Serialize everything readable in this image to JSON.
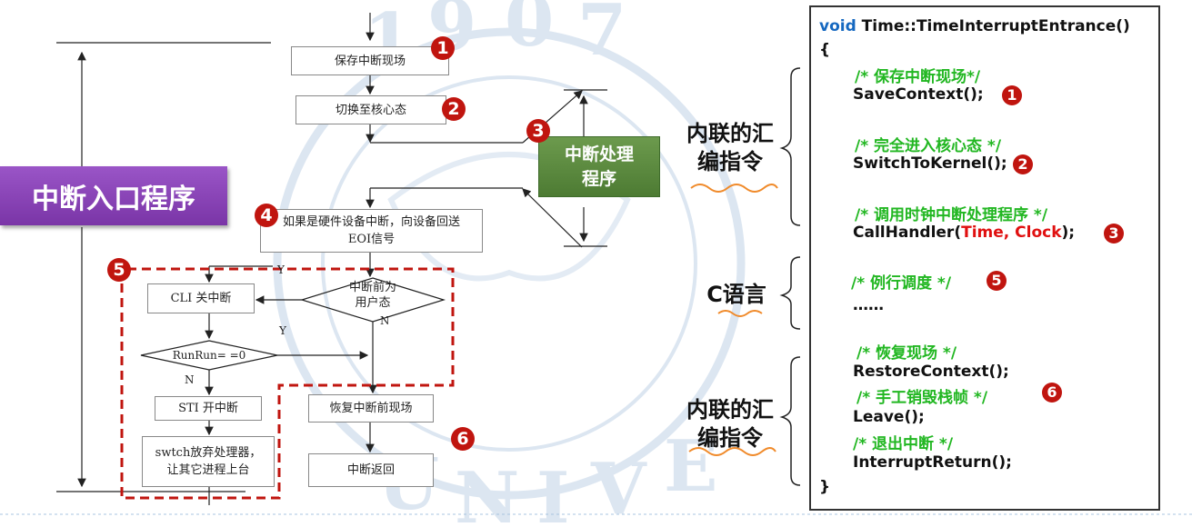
{
  "entry_label": "中断入口程序",
  "flowchart": {
    "save_context": "保存中断现场",
    "switch_kernel": "切换至核心态",
    "eoi_line1": "如果是硬件设备中断，向设备回送",
    "eoi_line2": "EOI信号",
    "cli": "CLI 关中断",
    "user_mode_line1": "中断前为",
    "user_mode_line2": "用户态",
    "runrun": "RunRun= =0",
    "sti": "STI 开中断",
    "switch_line1": "swtch放弃处理器，",
    "switch_line2": "让其它进程上台",
    "restore": "恢复中断前现场",
    "return": "中断返回",
    "label_y_top": "Y",
    "label_n_right": "N",
    "label_y_mid": "Y",
    "label_n_bottom": "N"
  },
  "handler_box": {
    "line1": "中断处理",
    "line2": "程序"
  },
  "badges": {
    "b1": "1",
    "b2": "2",
    "b3": "3",
    "b4": "4",
    "b5": "5",
    "b6": "6"
  },
  "side_labels": {
    "inline_asm_top_1": "内联的汇",
    "inline_asm_top_2": "编指令",
    "c_lang": "C语言",
    "inline_asm_bottom_1": "内联的汇",
    "inline_asm_bottom_2": "编指令"
  },
  "code": {
    "kw_void": "void",
    "func_sig": " Time::TimeInterruptEntrance()",
    "open_brace": "{",
    "c1": "/* 保存中断现场*/",
    "l1": "SaveContext();",
    "c2": "/* 完全进入核心态 */",
    "l2": "SwitchToKernel();",
    "c3": "/* 调用时钟中断处理程序 */",
    "l3_pre": "CallHandler(",
    "l3_args": "Time, Clock",
    "l3_post": ");",
    "c5": "/* 例行调度 */",
    "dots": "……",
    "c6a": "/* 恢复现场 */",
    "l6a": "RestoreContext();",
    "c6b": "/* 手工销毁栈帧 */",
    "l6b": "Leave();",
    "c6c": "/* 退出中断 */",
    "l6c": "InterruptReturn();",
    "close_brace": "}"
  },
  "colors": {
    "badge": "#c0150f",
    "comment": "#22b722",
    "keyword": "#1568c0",
    "args": "#e01010",
    "entry_label": "#8a45b7",
    "handler_box": "#5a8a3e",
    "dashed_box": "#c0150f"
  }
}
